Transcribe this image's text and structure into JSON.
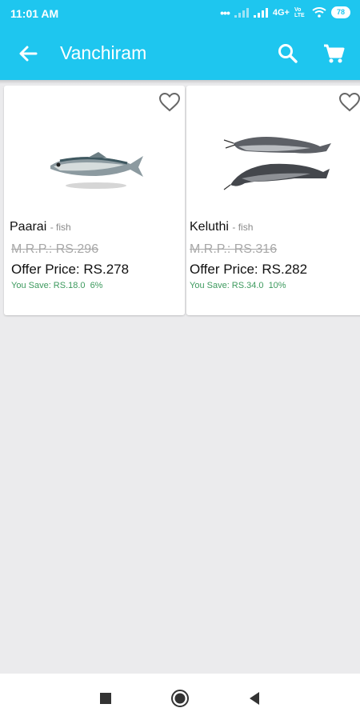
{
  "status": {
    "time": "11:01 AM",
    "network": "4G+",
    "lte": "Vo LTE",
    "battery": "78"
  },
  "app_bar": {
    "title": "Vanchiram",
    "back_icon": "arrow-back-icon",
    "search_icon": "search-icon",
    "cart_icon": "cart-icon"
  },
  "products": [
    {
      "name": "Paarai",
      "category": "- fish",
      "mrp": "M.R.P.: RS.296",
      "offer_price": "Offer Price: RS.278",
      "you_save": "You Save: RS.18.0",
      "discount": "6%"
    },
    {
      "name": "Keluthi",
      "category": "- fish",
      "mrp": "M.R.P.: RS.316",
      "offer_price": "Offer Price: RS.282",
      "you_save": "You Save: RS.34.0",
      "discount": "10%"
    }
  ],
  "colors": {
    "primary": "#1ec6ef",
    "save_green": "#3d9a5e",
    "background": "#ebebed"
  }
}
